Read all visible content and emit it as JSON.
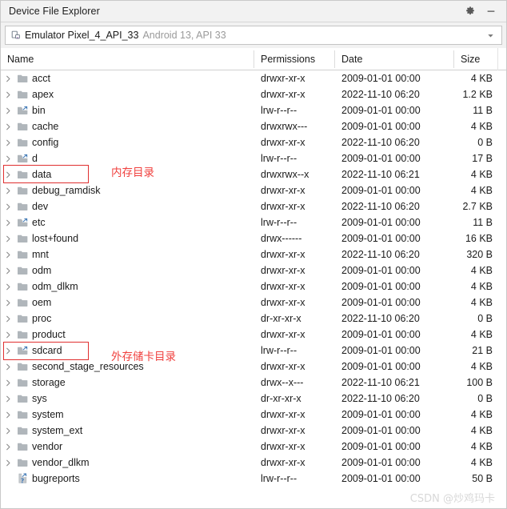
{
  "window": {
    "title": "Device File Explorer",
    "settings_icon": "gear-icon",
    "minimize_icon": "minimize-icon"
  },
  "device": {
    "icon": "device-phone-icon",
    "name": "Emulator Pixel_4_API_33",
    "meta": "Android 13, API 33",
    "dropdown_icon": "chevron-down-icon"
  },
  "columns": [
    {
      "key": "name",
      "label": "Name"
    },
    {
      "key": "permissions",
      "label": "Permissions"
    },
    {
      "key": "date",
      "label": "Date"
    },
    {
      "key": "size",
      "label": "Size"
    }
  ],
  "rows": [
    {
      "name": "acct",
      "icon": "folder-icon",
      "expandable": true,
      "permissions": "drwxr-xr-x",
      "date": "2009-01-01 00:00",
      "size": "4 KB"
    },
    {
      "name": "apex",
      "icon": "folder-icon",
      "expandable": true,
      "permissions": "drwxr-xr-x",
      "date": "2022-11-10 06:20",
      "size": "1.2 KB"
    },
    {
      "name": "bin",
      "icon": "folder-symlink-icon",
      "expandable": true,
      "permissions": "lrw-r--r--",
      "date": "2009-01-01 00:00",
      "size": "11 B"
    },
    {
      "name": "cache",
      "icon": "folder-icon",
      "expandable": true,
      "permissions": "drwxrwx---",
      "date": "2009-01-01 00:00",
      "size": "4 KB"
    },
    {
      "name": "config",
      "icon": "folder-icon",
      "expandable": true,
      "permissions": "drwxr-xr-x",
      "date": "2022-11-10 06:20",
      "size": "0 B"
    },
    {
      "name": "d",
      "icon": "folder-symlink-icon",
      "expandable": true,
      "permissions": "lrw-r--r--",
      "date": "2009-01-01 00:00",
      "size": "17 B"
    },
    {
      "name": "data",
      "icon": "folder-icon",
      "expandable": true,
      "permissions": "drwxrwx--x",
      "date": "2022-11-10 06:21",
      "size": "4 KB"
    },
    {
      "name": "debug_ramdisk",
      "icon": "folder-icon",
      "expandable": true,
      "permissions": "drwxr-xr-x",
      "date": "2009-01-01 00:00",
      "size": "4 KB"
    },
    {
      "name": "dev",
      "icon": "folder-icon",
      "expandable": true,
      "permissions": "drwxr-xr-x",
      "date": "2022-11-10 06:20",
      "size": "2.7 KB"
    },
    {
      "name": "etc",
      "icon": "folder-symlink-icon",
      "expandable": true,
      "permissions": "lrw-r--r--",
      "date": "2009-01-01 00:00",
      "size": "11 B"
    },
    {
      "name": "lost+found",
      "icon": "folder-icon",
      "expandable": true,
      "permissions": "drwx------",
      "date": "2009-01-01 00:00",
      "size": "16 KB"
    },
    {
      "name": "mnt",
      "icon": "folder-icon",
      "expandable": true,
      "permissions": "drwxr-xr-x",
      "date": "2022-11-10 06:20",
      "size": "320 B"
    },
    {
      "name": "odm",
      "icon": "folder-icon",
      "expandable": true,
      "permissions": "drwxr-xr-x",
      "date": "2009-01-01 00:00",
      "size": "4 KB"
    },
    {
      "name": "odm_dlkm",
      "icon": "folder-icon",
      "expandable": true,
      "permissions": "drwxr-xr-x",
      "date": "2009-01-01 00:00",
      "size": "4 KB"
    },
    {
      "name": "oem",
      "icon": "folder-icon",
      "expandable": true,
      "permissions": "drwxr-xr-x",
      "date": "2009-01-01 00:00",
      "size": "4 KB"
    },
    {
      "name": "proc",
      "icon": "folder-icon",
      "expandable": true,
      "permissions": "dr-xr-xr-x",
      "date": "2022-11-10 06:20",
      "size": "0 B"
    },
    {
      "name": "product",
      "icon": "folder-icon",
      "expandable": true,
      "permissions": "drwxr-xr-x",
      "date": "2009-01-01 00:00",
      "size": "4 KB"
    },
    {
      "name": "sdcard",
      "icon": "folder-symlink-icon",
      "expandable": true,
      "permissions": "lrw-r--r--",
      "date": "2009-01-01 00:00",
      "size": "21 B"
    },
    {
      "name": "second_stage_resources",
      "icon": "folder-icon",
      "expandable": true,
      "permissions": "drwxr-xr-x",
      "date": "2009-01-01 00:00",
      "size": "4 KB"
    },
    {
      "name": "storage",
      "icon": "folder-icon",
      "expandable": true,
      "permissions": "drwx--x---",
      "date": "2022-11-10 06:21",
      "size": "100 B"
    },
    {
      "name": "sys",
      "icon": "folder-icon",
      "expandable": true,
      "permissions": "dr-xr-xr-x",
      "date": "2022-11-10 06:20",
      "size": "0 B"
    },
    {
      "name": "system",
      "icon": "folder-icon",
      "expandable": true,
      "permissions": "drwxr-xr-x",
      "date": "2009-01-01 00:00",
      "size": "4 KB"
    },
    {
      "name": "system_ext",
      "icon": "folder-icon",
      "expandable": true,
      "permissions": "drwxr-xr-x",
      "date": "2009-01-01 00:00",
      "size": "4 KB"
    },
    {
      "name": "vendor",
      "icon": "folder-icon",
      "expandable": true,
      "permissions": "drwxr-xr-x",
      "date": "2009-01-01 00:00",
      "size": "4 KB"
    },
    {
      "name": "vendor_dlkm",
      "icon": "folder-icon",
      "expandable": true,
      "permissions": "drwxr-xr-x",
      "date": "2009-01-01 00:00",
      "size": "4 KB"
    },
    {
      "name": "bugreports",
      "icon": "file-symlink-unknown-icon",
      "expandable": false,
      "permissions": "lrw-r--r--",
      "date": "2009-01-01 00:00",
      "size": "50 B"
    }
  ],
  "annotations": [
    {
      "id": "data-annotation",
      "text": "内存目录",
      "target_row": "data"
    },
    {
      "id": "sdcard-annotation",
      "text": "外存储卡目录",
      "target_row": "sdcard"
    }
  ],
  "watermark": {
    "text": "CSDN @炒鸡玛卡"
  },
  "colors": {
    "annotation_red": "#f0403e",
    "folder_gray": "#b0b6bb",
    "text": "#1b1b1b",
    "muted_text": "#9a9a9a",
    "titlebar_bg": "#f2f2f2"
  }
}
